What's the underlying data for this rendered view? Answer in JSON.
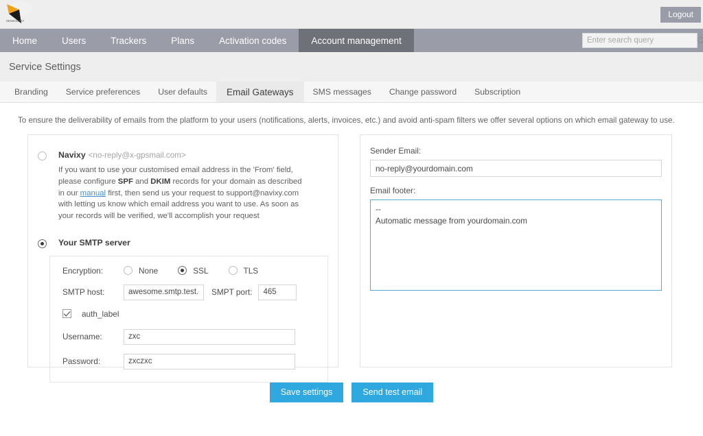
{
  "brand": {
    "logo_text": "SENSOLOGY",
    "accent": "#2fa8e0"
  },
  "header": {
    "logout_label": "Logout"
  },
  "nav": {
    "items": [
      {
        "label": "Home",
        "active": false
      },
      {
        "label": "Users",
        "active": false
      },
      {
        "label": "Trackers",
        "active": false
      },
      {
        "label": "Plans",
        "active": false
      },
      {
        "label": "Activation codes",
        "active": false
      },
      {
        "label": "Account management",
        "active": true
      }
    ]
  },
  "search": {
    "placeholder": "Enter search query",
    "value": "",
    "icon": "search-icon"
  },
  "page": {
    "title": "Service Settings"
  },
  "subtabs": {
    "items": [
      {
        "label": "Branding",
        "active": false
      },
      {
        "label": "Service preferences",
        "active": false
      },
      {
        "label": "User defaults",
        "active": false
      },
      {
        "label": "Email Gateways",
        "active": true
      },
      {
        "label": "SMS messages",
        "active": false
      },
      {
        "label": "Change password",
        "active": false
      },
      {
        "label": "Subscription",
        "active": false
      }
    ]
  },
  "main": {
    "intro": "To ensure the deliverability of emails from the platform to your users (notifications, alerts, invoices, etc.) and avoid anti-spam filters we offer several options on which email gateway to use.",
    "navixy_option": {
      "selected": false,
      "title": "Navixy",
      "address": "<no-reply@x-gpsmail.com>",
      "desc_1": "If you want to use your customised email address in the 'From' field, please configure ",
      "desc_bold_1": "SPF",
      "desc_2": " and ",
      "desc_bold_2": "DKIM",
      "desc_3": " records for your domain as described in our ",
      "desc_link": "manual",
      "desc_4": " first, then send us your request to support@navixy.com with letting us know which email address you want to use. As soon as your records will be verified, we'll accomplish your request"
    },
    "smtp_option": {
      "selected": true,
      "title": "Your SMTP server",
      "encryption_label": "Encryption:",
      "encryption_options": [
        {
          "label": "None",
          "selected": false
        },
        {
          "label": "SSL",
          "selected": true
        },
        {
          "label": "TLS",
          "selected": false
        }
      ],
      "host_label": "SMTP host:",
      "host_value": "awesome.smtp.test.com",
      "port_label": "SMPT port:",
      "port_value": "465",
      "auth_label": "auth_label",
      "auth_checked": true,
      "username_label": "Username:",
      "username_value": "zxc",
      "password_label": "Password:",
      "password_value": "zxczxc"
    },
    "right": {
      "sender_email_label": "Sender Email:",
      "sender_email_value": "no-reply@yourdomain.com",
      "footer_label": "Email footer:",
      "footer_value": "--\nAutomatic message from yourdomain.com"
    },
    "buttons": {
      "save_label": "Save settings",
      "test_label": "Send test email"
    }
  }
}
